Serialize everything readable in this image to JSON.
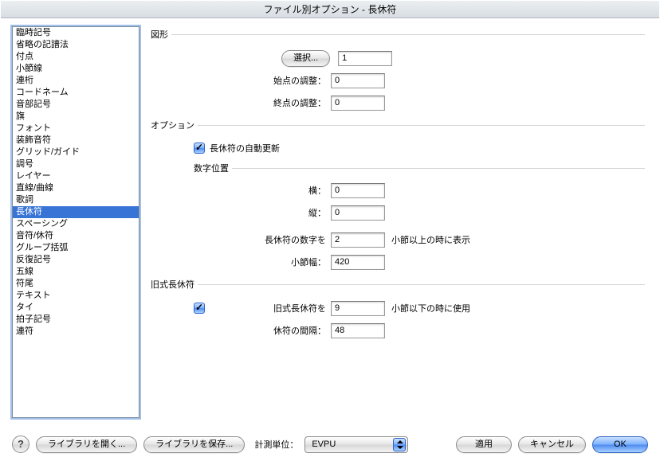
{
  "title": "ファイル別オプション - 長休符",
  "sidebar": {
    "items": [
      "臨時記号",
      "省略の記譜法",
      "付点",
      "小節線",
      "連桁",
      "コードネーム",
      "音部記号",
      "旗",
      "フォント",
      "装飾音符",
      "グリッド/ガイド",
      "調号",
      "レイヤー",
      "直線/曲線",
      "歌詞",
      "長休符",
      "スペーシング",
      "音符/休符",
      "グループ括弧",
      "反復記号",
      "五線",
      "符尾",
      "テキスト",
      "タイ",
      "拍子記号",
      "連符"
    ],
    "selectedIndex": 15
  },
  "shape": {
    "title": "図形",
    "select_btn": "選択...",
    "id_value": "1",
    "start_label": "始点の調整：",
    "start_value": "0",
    "end_label": "終点の調整：",
    "end_value": "0"
  },
  "options": {
    "title": "オプション",
    "auto_update_label": "長休符の自動更新",
    "auto_update_checked": true,
    "numpos": {
      "title": "数字位置",
      "h_label": "横：",
      "h_value": "0",
      "v_label": "縦：",
      "v_value": "0"
    },
    "threshold_label": "長休符の数字を",
    "threshold_value": "2",
    "threshold_suffix": "小節以上の時に表示",
    "width_label": "小節幅：",
    "width_value": "420"
  },
  "old": {
    "title": "旧式長休符",
    "use_old_label": "旧式長休符を",
    "use_old_checked": true,
    "use_old_value": "9",
    "use_old_suffix": "小節以下の時に使用",
    "spacing_label": "休符の間隔：",
    "spacing_value": "48"
  },
  "footer": {
    "help": "?",
    "open_lib": "ライブラリを開く...",
    "save_lib": "ライブラリを保存...",
    "unit_label": "計測単位：",
    "unit_value": "EVPU",
    "apply": "適用",
    "cancel": "キャンセル",
    "ok": "OK"
  }
}
